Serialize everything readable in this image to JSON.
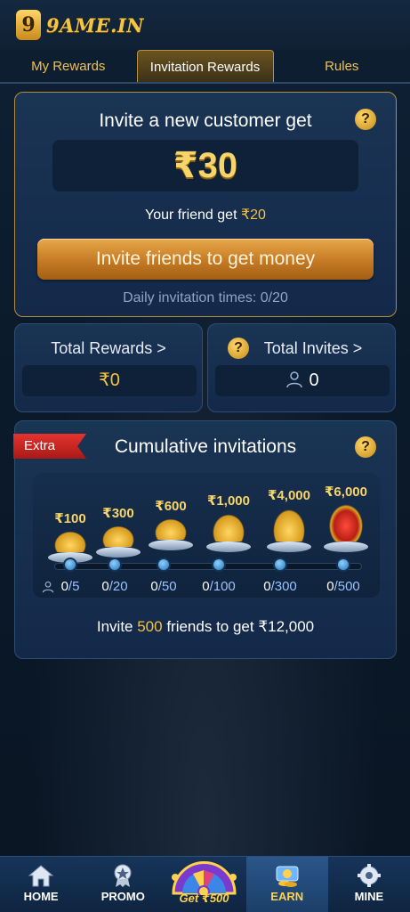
{
  "app": {
    "logo_mark": "9",
    "logo_text": "9AME.IN"
  },
  "tabs": [
    {
      "label": "My Rewards"
    },
    {
      "label": "Invitation Rewards"
    },
    {
      "label": "Rules"
    }
  ],
  "invite": {
    "title": "Invite a new customer get",
    "amount": "₹30",
    "friend_get_prefix": "Your friend get ",
    "friend_get_amount": "₹20",
    "button_label": "Invite friends to get money",
    "daily_times": "Daily invitation times: 0/20",
    "help_icon": "?"
  },
  "stats": {
    "total_rewards_label": "Total Rewards >",
    "total_rewards_value": "₹0",
    "total_invites_label": "Total Invites >",
    "total_invites_value": "0",
    "help_icon": "?"
  },
  "cumulative": {
    "badge": "Extra",
    "title": "Cumulative invitations",
    "help_icon": "?",
    "tiers": [
      {
        "amount": "₹100",
        "current": "0",
        "goal": "/5"
      },
      {
        "amount": "₹300",
        "current": "0",
        "goal": "/20"
      },
      {
        "amount": "₹600",
        "current": "0",
        "goal": "/50"
      },
      {
        "amount": "₹1,000",
        "current": "0",
        "goal": "/100"
      },
      {
        "amount": "₹4,000",
        "current": "0",
        "goal": "/300"
      },
      {
        "amount": "₹6,000",
        "current": "0",
        "goal": "/500"
      }
    ],
    "footer_prefix": "Invite ",
    "footer_count": "500",
    "footer_suffix": " friends to get ₹12,000"
  },
  "nav": {
    "items": [
      {
        "label": "HOME",
        "icon": "home-icon"
      },
      {
        "label": "PROMO",
        "icon": "promo-icon"
      },
      {
        "label": "Get ₹500",
        "icon": "wheel-icon"
      },
      {
        "label": "EARN",
        "icon": "earn-icon"
      },
      {
        "label": "MINE",
        "icon": "gear-icon"
      }
    ]
  },
  "colors": {
    "accent_gold": "#f4c23f",
    "card_bg": "#1a3454",
    "active_nav": "#2a568a"
  }
}
